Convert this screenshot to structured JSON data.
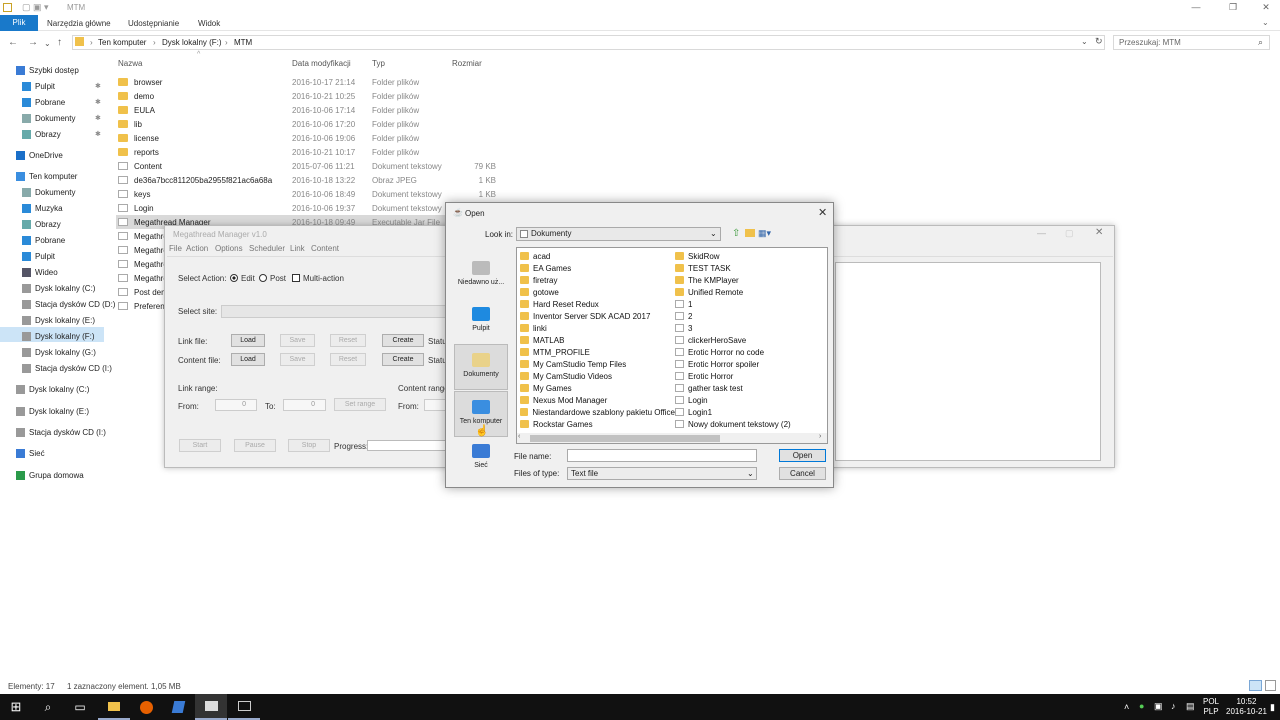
{
  "explorer": {
    "window_title": "MTM",
    "ribbon_tabs": [
      "Plik",
      "Narzędzia główne",
      "Udostępnianie",
      "Widok"
    ],
    "breadcrumb": [
      "Ten komputer",
      "Dysk lokalny (F:)",
      "MTM"
    ],
    "search_placeholder": "Przeszukaj: MTM",
    "columns": {
      "name": "Nazwa",
      "date": "Data modyfikacji",
      "type": "Typ",
      "size": "Rozmiar"
    },
    "nav": [
      {
        "label": "Szybki dostęp",
        "icon": "star-icon",
        "indent": 0
      },
      {
        "label": "Pulpit",
        "icon": "desktop-icon",
        "indent": 1
      },
      {
        "label": "Pobrane",
        "icon": "download-icon",
        "indent": 1
      },
      {
        "label": "Dokumenty",
        "icon": "documents-icon",
        "indent": 1
      },
      {
        "label": "Obrazy",
        "icon": "pictures-icon",
        "indent": 1
      },
      {
        "label": "OneDrive",
        "icon": "cloud-icon",
        "indent": 0
      },
      {
        "label": "Ten komputer",
        "icon": "computer-icon",
        "indent": 0
      },
      {
        "label": "Dokumenty",
        "icon": "documents-icon",
        "indent": 1
      },
      {
        "label": "Muzyka",
        "icon": "music-icon",
        "indent": 1
      },
      {
        "label": "Obrazy",
        "icon": "pictures-icon",
        "indent": 1
      },
      {
        "label": "Pobrane",
        "icon": "download-icon",
        "indent": 1
      },
      {
        "label": "Pulpit",
        "icon": "desktop-icon",
        "indent": 1
      },
      {
        "label": "Wideo",
        "icon": "video-icon",
        "indent": 1
      },
      {
        "label": "Dysk lokalny (C:)",
        "icon": "drive-icon",
        "indent": 1
      },
      {
        "label": "Stacja dysków CD (D:)",
        "icon": "cd-drive-icon",
        "indent": 1
      },
      {
        "label": "Dysk lokalny (E:)",
        "icon": "drive-icon",
        "indent": 1
      },
      {
        "label": "Dysk lokalny (F:)",
        "icon": "drive-icon",
        "indent": 1
      },
      {
        "label": "Dysk lokalny (G:)",
        "icon": "drive-icon",
        "indent": 1
      },
      {
        "label": "Stacja dysków CD (I:)",
        "icon": "cd-drive-icon",
        "indent": 1
      },
      {
        "label": "Dysk lokalny (C:)",
        "icon": "drive-icon",
        "indent": 0
      },
      {
        "label": "Dysk lokalny (E:)",
        "icon": "drive-icon",
        "indent": 0
      },
      {
        "label": "Stacja dysków CD (I:)",
        "icon": "cd-drive-icon",
        "indent": 0
      },
      {
        "label": "Sieć",
        "icon": "network-icon",
        "indent": 0
      },
      {
        "label": "Grupa domowa",
        "icon": "homegroup-icon",
        "indent": 0
      }
    ],
    "files": [
      {
        "name": "browser",
        "date": "2016-10-17 21:14",
        "type": "Folder plików",
        "size": "",
        "kind": "folder"
      },
      {
        "name": "demo",
        "date": "2016-10-21 10:25",
        "type": "Folder plików",
        "size": "",
        "kind": "folder"
      },
      {
        "name": "EULA",
        "date": "2016-10-06 17:14",
        "type": "Folder plików",
        "size": "",
        "kind": "folder"
      },
      {
        "name": "lib",
        "date": "2016-10-06 17:20",
        "type": "Folder plików",
        "size": "",
        "kind": "folder"
      },
      {
        "name": "license",
        "date": "2016-10-06 19:06",
        "type": "Folder plików",
        "size": "",
        "kind": "folder"
      },
      {
        "name": "reports",
        "date": "2016-10-21 10:17",
        "type": "Folder plików",
        "size": "",
        "kind": "folder"
      },
      {
        "name": "Content",
        "date": "2015-07-06 11:21",
        "type": "Dokument tekstowy",
        "size": "79 KB",
        "kind": "doc"
      },
      {
        "name": "de36a7bcc811205ba2955f821ac6a68a",
        "date": "2016-10-18 13:22",
        "type": "Obraz JPEG",
        "size": "1 KB",
        "kind": "doc"
      },
      {
        "name": "keys",
        "date": "2016-10-06 18:49",
        "type": "Dokument tekstowy",
        "size": "1 KB",
        "kind": "doc"
      },
      {
        "name": "Login",
        "date": "2016-10-06 19:37",
        "type": "Dokument tekstowy",
        "size": "1 KB",
        "kind": "doc"
      },
      {
        "name": "Megathread Manager",
        "date": "2016-10-18 09:49",
        "type": "Executable Jar File",
        "size": "",
        "kind": "doc",
        "selected": true
      },
      {
        "name": "Megathre",
        "date": "",
        "type": "",
        "size": "",
        "kind": "doc"
      },
      {
        "name": "Megathre",
        "date": "",
        "type": "",
        "size": "",
        "kind": "doc"
      },
      {
        "name": "Megathre",
        "date": "",
        "type": "",
        "size": "",
        "kind": "doc"
      },
      {
        "name": "Megathre",
        "date": "",
        "type": "",
        "size": "",
        "kind": "doc"
      },
      {
        "name": "Post dem",
        "date": "",
        "type": "",
        "size": "",
        "kind": "doc"
      },
      {
        "name": "Preferenc",
        "date": "",
        "type": "",
        "size": "",
        "kind": "doc"
      }
    ],
    "status_count": "Elementy: 17",
    "status_selection": "1 zaznaczony element. 1,05 MB"
  },
  "mtm_app": {
    "title": "Megathread Manager v1.0",
    "menu": [
      "File",
      "Action",
      "Options",
      "Scheduler",
      "Link",
      "Content"
    ],
    "select_action_label": "Select Action:",
    "radio_edit": "Edit",
    "radio_post": "Post",
    "check_multi": "Multi-action",
    "select_site_label": "Select site:",
    "link_file_label": "Link file:",
    "content_file_label": "Content file:",
    "btn_load": "Load",
    "btn_save": "Save",
    "btn_reset": "Reset",
    "btn_create": "Create",
    "status_label": "Status",
    "link_range_label": "Link range:",
    "content_range_label": "Content range",
    "from_label": "From:",
    "to_label": "To:",
    "from_value": "0",
    "to_value": "0",
    "set_range": "Set range",
    "btn_start": "Start",
    "btn_pause": "Pause",
    "btn_stop": "Stop",
    "progress_label": "Progress:"
  },
  "open_dialog": {
    "title": "Open",
    "look_in_label": "Look in:",
    "look_in_value": "Dokumenty",
    "places": [
      {
        "label": "Niedawno uż...",
        "icon": "recent-icon",
        "selected": false
      },
      {
        "label": "Pulpit",
        "icon": "desktop-icon",
        "selected": false
      },
      {
        "label": "Dokumenty",
        "icon": "documents-icon",
        "selected": true
      },
      {
        "label": "Ten komputer",
        "icon": "computer-icon",
        "selected": true
      },
      {
        "label": "Sieć",
        "icon": "network-icon",
        "selected": false
      }
    ],
    "col1": [
      {
        "name": "acad",
        "kind": "folder"
      },
      {
        "name": "EA Games",
        "kind": "folder"
      },
      {
        "name": "firetray",
        "kind": "folder"
      },
      {
        "name": "gotowe",
        "kind": "folder"
      },
      {
        "name": "Hard Reset Redux",
        "kind": "folder"
      },
      {
        "name": "Inventor Server SDK ACAD 2017",
        "kind": "folder"
      },
      {
        "name": "linki",
        "kind": "folder"
      },
      {
        "name": "MATLAB",
        "kind": "folder"
      },
      {
        "name": "MTM_PROFILE",
        "kind": "folder"
      },
      {
        "name": "My CamStudio Temp Files",
        "kind": "folder"
      },
      {
        "name": "My CamStudio Videos",
        "kind": "folder"
      },
      {
        "name": "My Games",
        "kind": "folder"
      },
      {
        "name": "Nexus Mod Manager",
        "kind": "folder"
      },
      {
        "name": "Niestandardowe szablony pakietu Office",
        "kind": "folder"
      },
      {
        "name": "Rockstar Games",
        "kind": "folder"
      }
    ],
    "col2": [
      {
        "name": "SkidRow",
        "kind": "folder"
      },
      {
        "name": "TEST TASK",
        "kind": "folder"
      },
      {
        "name": "The KMPlayer",
        "kind": "folder"
      },
      {
        "name": "Unified Remote",
        "kind": "folder"
      },
      {
        "name": "1",
        "kind": "doc"
      },
      {
        "name": "2",
        "kind": "doc"
      },
      {
        "name": "3",
        "kind": "doc"
      },
      {
        "name": "clickerHeroSave",
        "kind": "doc"
      },
      {
        "name": "Erotic Horror no code",
        "kind": "doc"
      },
      {
        "name": "Erotic Horror spoiler",
        "kind": "doc"
      },
      {
        "name": "Erotic Horror",
        "kind": "doc"
      },
      {
        "name": "gather task test",
        "kind": "doc"
      },
      {
        "name": "Login",
        "kind": "doc"
      },
      {
        "name": "Login1",
        "kind": "doc"
      },
      {
        "name": "Nowy dokument tekstowy (2)",
        "kind": "doc"
      }
    ],
    "file_name_label": "File name:",
    "file_name_value": "",
    "files_of_type_label": "Files of type:",
    "files_of_type_value": "Text file",
    "btn_open": "Open",
    "btn_cancel": "Cancel"
  },
  "taskbar": {
    "lang_top": "POL",
    "lang_bottom": "PLP",
    "time": "10:52",
    "date": "2016-10-21"
  }
}
